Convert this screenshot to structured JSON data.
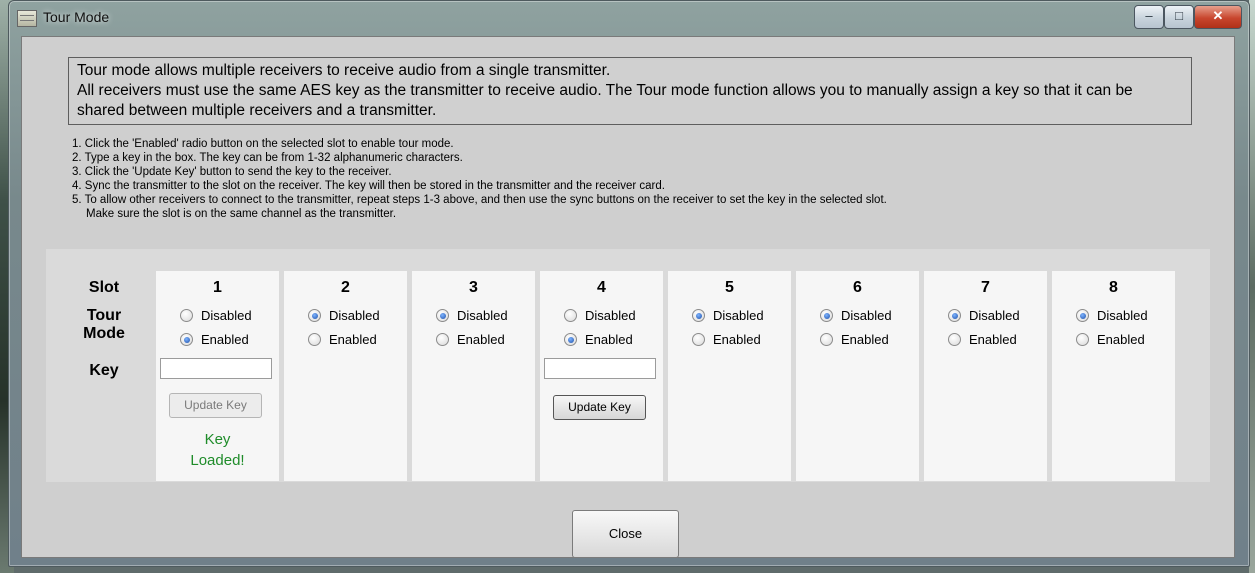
{
  "window": {
    "title": "Tour Mode",
    "minimize_label": "‒",
    "maximize_label": "□",
    "close_label": "✕"
  },
  "intro": {
    "line1": "Tour mode allows multiple receivers to receive audio from a single transmitter.",
    "line2": "All receivers must use the same AES key as the transmitter to receive audio. The Tour mode function allows you to manually assign a key so that it can be shared between multiple receivers and a transmitter."
  },
  "steps": [
    "1. Click the 'Enabled' radio button on the selected slot to enable tour mode.",
    "2. Type a key in the box. The key can be from 1-32 alphanumeric characters.",
    "3. Click the 'Update Key' button to send the key to the receiver.",
    "4. Sync the transmitter to the slot on the receiver. The key will then be stored in the transmitter and the receiver card.",
    "5. To allow other receivers to connect to the transmitter, repeat steps 1-3 above, and then use the sync buttons on the receiver to set the key in the selected slot.",
    "Make sure the slot is on the same channel as the transmitter."
  ],
  "labels": {
    "slot": "Slot",
    "tour_mode": "Tour\nMode",
    "key": "Key"
  },
  "slots": [
    {
      "number": "1",
      "disabled": "Disabled",
      "enabled": "Enabled",
      "key_value": "",
      "update_label": "Update Key",
      "status": "Key\nLoaded!"
    },
    {
      "number": "2",
      "disabled": "Disabled",
      "enabled": "Enabled"
    },
    {
      "number": "3",
      "disabled": "Disabled",
      "enabled": "Enabled"
    },
    {
      "number": "4",
      "disabled": "Disabled",
      "enabled": "Enabled",
      "key_value": "",
      "update_label": "Update Key"
    },
    {
      "number": "5",
      "disabled": "Disabled",
      "enabled": "Enabled"
    },
    {
      "number": "6",
      "disabled": "Disabled",
      "enabled": "Enabled"
    },
    {
      "number": "7",
      "disabled": "Disabled",
      "enabled": "Enabled"
    },
    {
      "number": "8",
      "disabled": "Disabled",
      "enabled": "Enabled"
    }
  ],
  "close_button": "Close",
  "colors": {
    "status_green": "#1f8c2a",
    "radio_blue": "#1d4fa8"
  }
}
